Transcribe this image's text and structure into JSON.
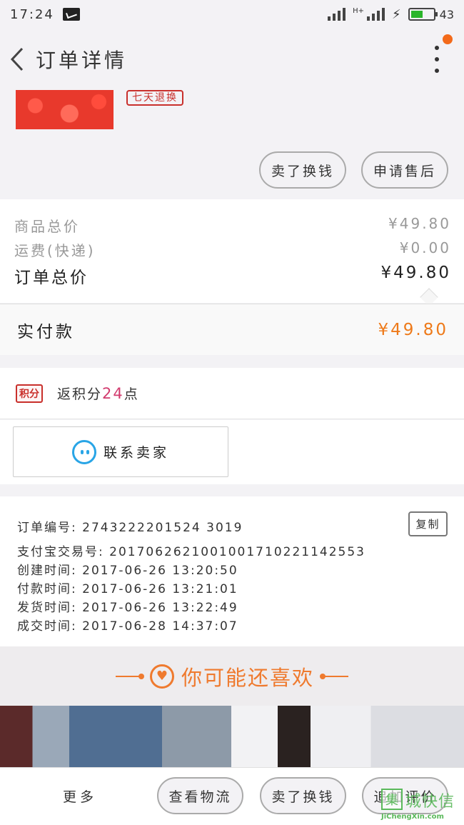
{
  "status_bar": {
    "time": "17:24",
    "net_label": "H+",
    "battery_level": 0.55,
    "battery_text": "43"
  },
  "nav": {
    "title": "订单详情"
  },
  "product": {
    "tag": "七天退换"
  },
  "actions_top": {
    "refund": "卖了换钱",
    "after_sale": "申请售后"
  },
  "price": {
    "goods_label": "商品总价",
    "goods_value": "¥49.80",
    "shipping_label": "运费(快递)",
    "shipping_value": "¥0.00",
    "order_label": "订单总价",
    "order_value": "¥49.80",
    "paid_label": "实付款",
    "paid_value": "¥49.80"
  },
  "points": {
    "badge": "积分",
    "prefix": "返积分",
    "value": "24",
    "suffix": "点"
  },
  "contact": {
    "label": "联系卖家"
  },
  "order_info": {
    "order_no": "订单编号: 2743222201524 3019",
    "alipay_no": "支付宝交易号: 2017062621001001710221142553",
    "created": "创建时间: 2017-06-26  13:20:50",
    "paid": "付款时间: 2017-06-26  13:21:01",
    "shipped": "发货时间: 2017-06-26  13:22:49",
    "completed": "成交时间: 2017-06-28  14:37:07",
    "copy": "复制"
  },
  "recommend": {
    "title": "你可能还喜欢"
  },
  "bottom_bar": {
    "more": "更多",
    "logistics": "查看物流",
    "refund": "卖了换钱",
    "review": "追加评价"
  },
  "watermark": {
    "logo": "集",
    "name": "城快信",
    "url": "JiChengXin.com"
  },
  "colors": {
    "accent": "#ef7a2e",
    "points": "#d23b6e",
    "chat": "#29a5e6",
    "tag": "#c9302c"
  }
}
